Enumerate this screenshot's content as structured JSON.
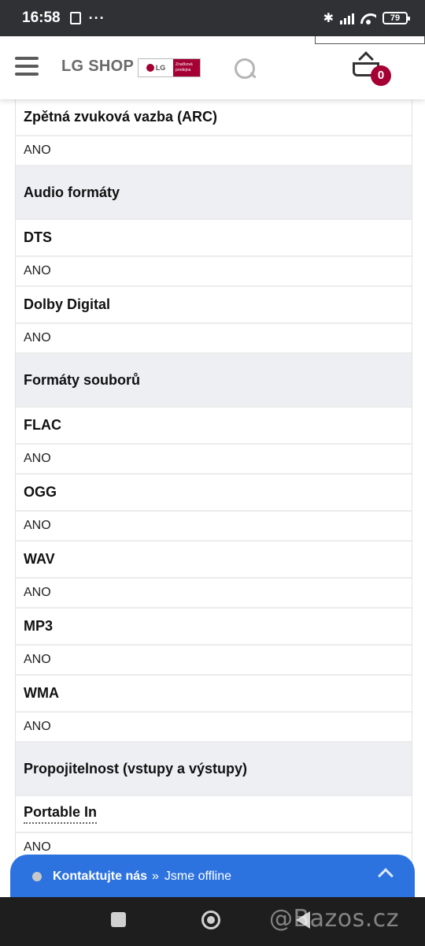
{
  "status_bar": {
    "time": "16:58",
    "dots": "···",
    "battery": "79"
  },
  "header": {
    "logo_text": "LG SHOP",
    "badge_lg": "LG",
    "badge_subtitle": "Značková prodejna",
    "cart_count": "0"
  },
  "specs": [
    {
      "kind": "label",
      "text": "Zpětná zvuková vazba (ARC)"
    },
    {
      "kind": "value",
      "text": "ANO"
    },
    {
      "kind": "section",
      "text": "Audio formáty"
    },
    {
      "kind": "label",
      "text": "DTS"
    },
    {
      "kind": "value",
      "text": "ANO"
    },
    {
      "kind": "label",
      "text": "Dolby Digital"
    },
    {
      "kind": "value",
      "text": "ANO"
    },
    {
      "kind": "section",
      "text": "Formáty souborů"
    },
    {
      "kind": "label",
      "text": "FLAC"
    },
    {
      "kind": "value",
      "text": "ANO"
    },
    {
      "kind": "label",
      "text": "OGG"
    },
    {
      "kind": "value",
      "text": "ANO"
    },
    {
      "kind": "label",
      "text": "WAV"
    },
    {
      "kind": "value",
      "text": "ANO"
    },
    {
      "kind": "label",
      "text": "MP3"
    },
    {
      "kind": "value",
      "text": "ANO"
    },
    {
      "kind": "label",
      "text": "WMA"
    },
    {
      "kind": "value",
      "text": "ANO"
    },
    {
      "kind": "section",
      "text": "Propojitelnost (vstupy a výstupy)"
    },
    {
      "kind": "label",
      "text": "Portable In",
      "dotted": true
    },
    {
      "kind": "value",
      "text": "ANO"
    }
  ],
  "chat": {
    "title": "Kontaktujte nás",
    "separator": "»",
    "status": "Jsme offline"
  },
  "watermark": "@Bazos.cz",
  "colors": {
    "brand": "#a50034",
    "chat": "#2d73e0",
    "section_bg": "#eeeff3"
  }
}
